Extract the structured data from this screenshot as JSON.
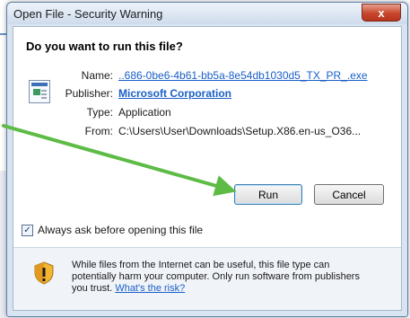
{
  "window": {
    "title": "Open File - Security Warning",
    "close_label": "x"
  },
  "dialog": {
    "question": "Do you want to run this file?",
    "name_label": "Name:",
    "name_value": "..686-0be6-4b61-bb5a-8e54db1030d5_TX_PR_.exe",
    "publisher_label": "Publisher:",
    "publisher_value": "Microsoft Corporation",
    "type_label": "Type:",
    "type_value": "Application",
    "from_label": "From:",
    "from_value": "C:\\Users\\User\\Downloads\\Setup.X86.en-us_O36...",
    "run_label": "Run",
    "cancel_label": "Cancel",
    "checkbox_label": "Always ask before opening this file",
    "checkbox_checked": true,
    "warning_text": "While files from the Internet can be useful, this file type can potentially harm your computer. Only run software from publishers you trust.",
    "risk_link": "What's the risk?"
  },
  "colors": {
    "accent_link": "#1a5fc7",
    "annotation_arrow": "#5dbb46",
    "close_button": "#c7462c"
  },
  "icons": {
    "file": "application-file-icon",
    "shield": "security-shield-icon",
    "annotation": "green-arrow-annotation"
  }
}
